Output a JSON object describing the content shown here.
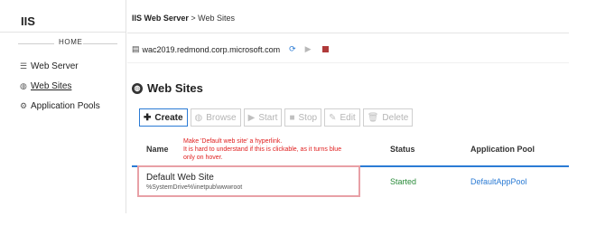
{
  "sidebar": {
    "app_title": "IIS",
    "section": "HOME",
    "items": [
      {
        "icon": "server-icon",
        "label": "Web Server"
      },
      {
        "icon": "globe-icon",
        "label": "Web Sites",
        "active": true
      },
      {
        "icon": "gears-icon",
        "label": "Application Pools"
      }
    ]
  },
  "breadcrumb": {
    "root": "IIS Web Server",
    "separator": ">",
    "current": "Web Sites"
  },
  "server": {
    "name": "wac2019.redmond.corp.microsoft.com",
    "icons": [
      "refresh-icon",
      "play-icon",
      "stop-icon"
    ]
  },
  "page": {
    "title": "Web Sites"
  },
  "toolbar": {
    "buttons": [
      {
        "icon": "plus-icon",
        "label": "Create",
        "enabled": true
      },
      {
        "icon": "globe-icon",
        "label": "Browse",
        "enabled": false
      },
      {
        "icon": "play-icon",
        "label": "Start",
        "enabled": false
      },
      {
        "icon": "stop-icon",
        "label": "Stop",
        "enabled": false
      },
      {
        "icon": "pencil-icon",
        "label": "Edit",
        "enabled": false
      },
      {
        "icon": "trash-icon",
        "label": "Delete",
        "enabled": false
      }
    ]
  },
  "table": {
    "columns": [
      "Name",
      "Status",
      "Application Pool"
    ],
    "rows": [
      {
        "name": "Default Web Site",
        "path": "%SystemDrive%\\inetpub\\wwwroot",
        "status": "Started",
        "pool": "DefaultAppPool"
      }
    ]
  },
  "annotation": {
    "lines": [
      "Make 'Default web site' a hyperlink.",
      "It is hard to understand if this is clickable, as it turns blue",
      "only on hover."
    ],
    "color": "#e02020"
  },
  "colors": {
    "accent": "#2b7bd4",
    "started": "#2a8b3a",
    "stop": "#b03a3a",
    "highlight": "#e8a0a6"
  }
}
